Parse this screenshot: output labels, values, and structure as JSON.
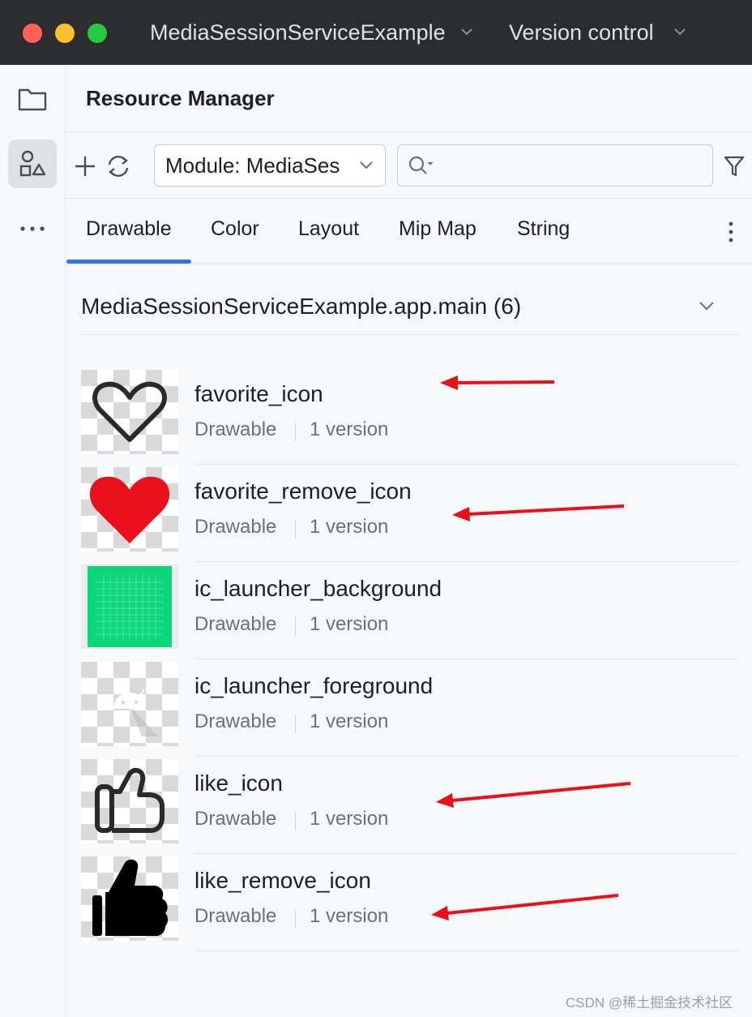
{
  "titlebar": {
    "project_name": "MediaSessionServiceExample",
    "vcs_label": "Version control"
  },
  "toolwindow": {
    "title": "Resource Manager"
  },
  "toolbar": {
    "module_select_value": "Module: MediaSes",
    "search_value": ""
  },
  "tabs": [
    {
      "label": "Drawable",
      "selected": true
    },
    {
      "label": "Color"
    },
    {
      "label": "Layout"
    },
    {
      "label": "Mip Map"
    },
    {
      "label": "String"
    }
  ],
  "group": {
    "label": "MediaSessionServiceExample.app.main (6)"
  },
  "resources": [
    {
      "name": "favorite_icon",
      "type": "Drawable",
      "versions": "1 version",
      "icon": "heart-outline-icon",
      "annotated": true
    },
    {
      "name": "favorite_remove_icon",
      "type": "Drawable",
      "versions": "1 version",
      "icon": "heart-filled-red-icon",
      "annotated": true
    },
    {
      "name": "ic_launcher_background",
      "type": "Drawable",
      "versions": "1 version",
      "icon": "green-grid-icon",
      "annotated": false
    },
    {
      "name": "ic_launcher_foreground",
      "type": "Drawable",
      "versions": "1 version",
      "icon": "android-robot-icon",
      "annotated": false
    },
    {
      "name": "like_icon",
      "type": "Drawable",
      "versions": "1 version",
      "icon": "thumbs-up-outline-icon",
      "annotated": true
    },
    {
      "name": "like_remove_icon",
      "type": "Drawable",
      "versions": "1 version",
      "icon": "thumbs-up-filled-icon",
      "annotated": true
    }
  ],
  "colors": {
    "titlebar_bg": "#2b2d30",
    "accent": "#3574f0",
    "annotation_arrow": "#e8101a",
    "heart_red": "#e8101a",
    "launcher_green": "#0bd67a"
  },
  "watermark": "CSDN @稀土掘金技术社区"
}
